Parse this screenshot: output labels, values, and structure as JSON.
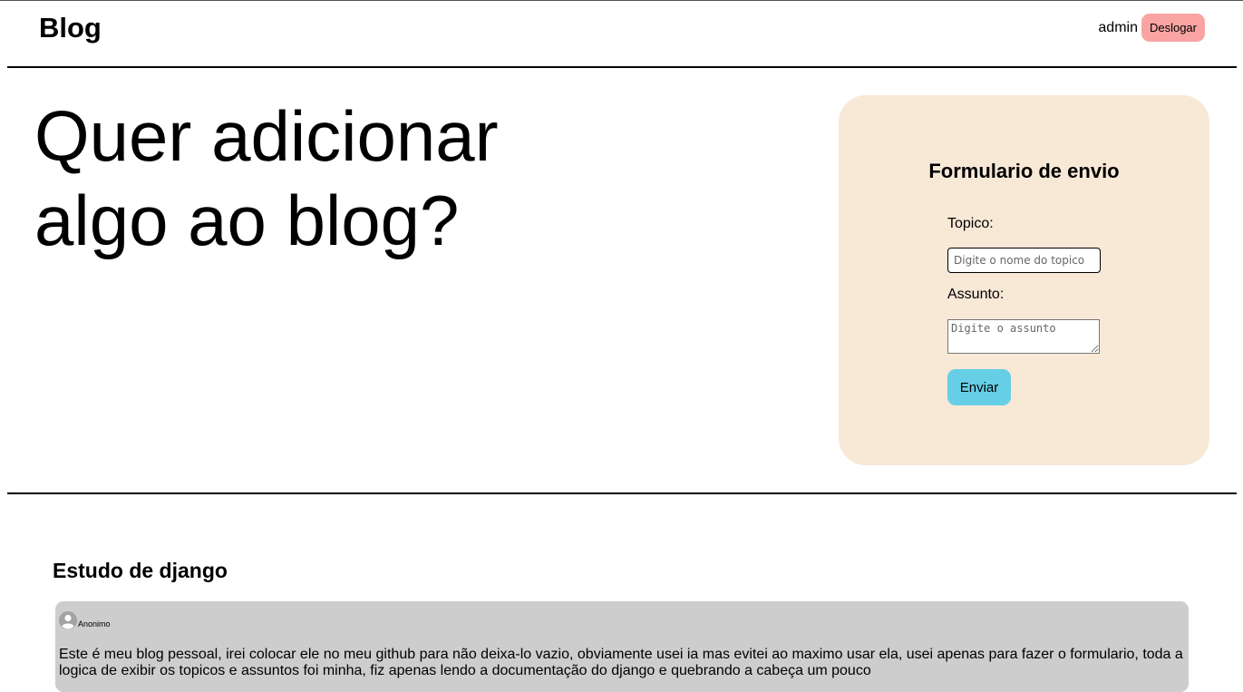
{
  "header": {
    "brand": "Blog",
    "username": "admin",
    "logout_label": "Deslogar"
  },
  "hero": {
    "title_line1": "Quer adicionar",
    "title_line2": "algo ao blog?"
  },
  "form": {
    "title": "Formulario de envio",
    "topic_label": "Topico:",
    "topic_value": "",
    "topic_placeholder": "Digite o nome do topico",
    "subject_label": "Assunto:",
    "subject_value": "",
    "subject_placeholder": "Digite o assunto",
    "submit_label": "Enviar"
  },
  "topics": [
    {
      "title": "Estudo de django",
      "posts": [
        {
          "author": "Anonimo",
          "author_icon": "user-avatar-icon",
          "text": "Este é meu blog pessoal, irei colocar ele no meu github para não deixa-lo vazio, obviamente usei ia mas evitei ao maximo usar ela, usei apenas para fazer o formulario, toda a logica de exibir os topicos e assuntos foi minha, fiz apenas lendo a documentação do django e quebrando a cabeça um pouco"
        }
      ]
    }
  ],
  "colors": {
    "logout_button": "#f9a3a3",
    "form_card": "#f8e8d6",
    "submit_button": "#66cfe6",
    "post_card": "#cdcdcd"
  }
}
